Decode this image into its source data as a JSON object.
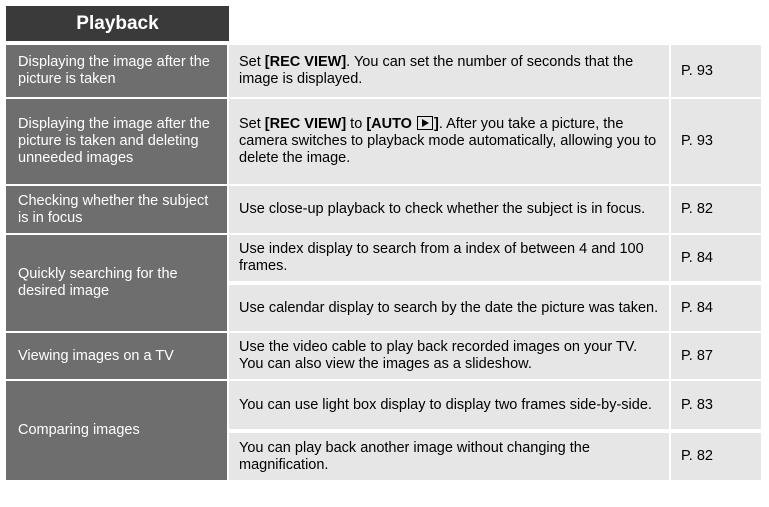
{
  "section_title": "Playback",
  "rows": [
    {
      "topic": "Displaying the image after the picture is taken",
      "desc_pre": "Set ",
      "desc_bold": "[REC VIEW]",
      "desc_post": ". You can set the number of seconds that the image is displayed.",
      "page": "P. 93"
    },
    {
      "topic": "Displaying the image after the picture is taken and deleting unneeded images",
      "desc_pre": "Set ",
      "desc_bold": "[REC VIEW]",
      "desc_mid": " to ",
      "desc_bold2": "[AUTO ",
      "desc_bold3": "]",
      "desc_post": ". After you take a picture, the camera switches to playback mode automatically, allowing you to delete the image.",
      "icon": "play-icon",
      "page": "P. 93"
    },
    {
      "topic": "Checking whether the subject is in focus",
      "desc": "Use close-up playback to check whether the subject is in focus.",
      "page": "P. 82"
    },
    {
      "topic": "Quickly searching for the desired image",
      "items": [
        {
          "desc": "Use index display to search from a index of between 4 and 100 frames.",
          "page": "P. 84"
        },
        {
          "desc": "Use calendar display to search by the date the picture was taken.",
          "page": "P. 84"
        }
      ]
    },
    {
      "topic": "Viewing images on a TV",
      "desc": "Use the video cable to play back recorded images on your TV. You can also view the images as a slideshow.",
      "page": "P. 87"
    },
    {
      "topic": "Comparing images",
      "items": [
        {
          "desc": "You can use light box display to display two frames side-by-side.",
          "page": "P. 83"
        },
        {
          "desc": "You can play back another image without changing the magnification.",
          "page": "P. 82"
        }
      ]
    }
  ],
  "colors": {
    "title_bg": "#3a3a3a",
    "topic_bg": "#6e6e6e",
    "cell_bg": "#e6e6e6"
  }
}
